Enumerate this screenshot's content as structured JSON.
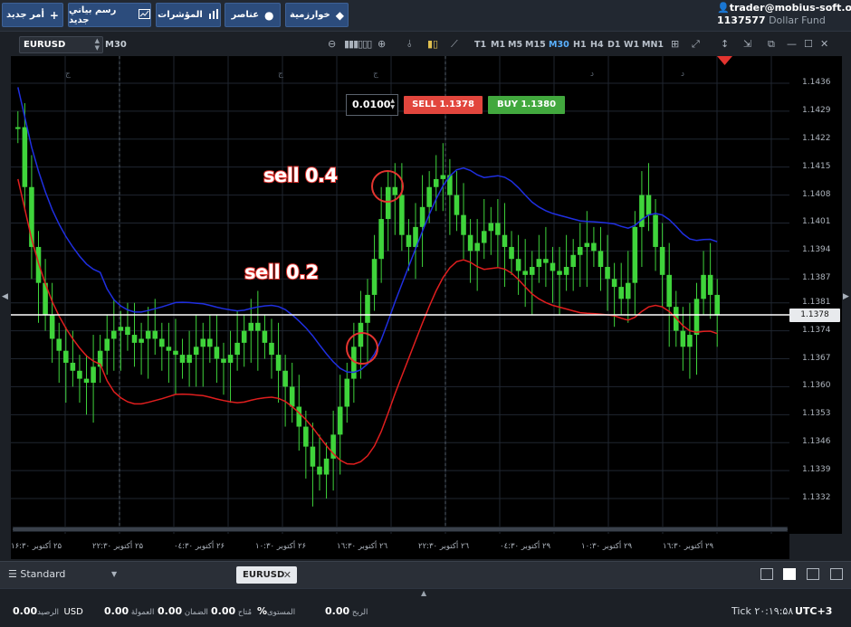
{
  "toolbar": {
    "new_order": "أمر جديد",
    "new_chart": "رسم بياني جديد",
    "indicators": "المؤشرات",
    "elements": "عناصر",
    "algorithms": "خوارزمية"
  },
  "account": {
    "user": "trader@mobius-soft.org",
    "number": "1137577",
    "fund": "Dollar Fund"
  },
  "chart": {
    "symbol": "EURUSD",
    "timeframe": "M30",
    "timeframes": [
      "T1",
      "M1",
      "M5",
      "M15",
      "M30",
      "H1",
      "H4",
      "D1",
      "W1",
      "MN1"
    ],
    "active_timeframe": "M30",
    "lot": "0.0100",
    "sell_label": "SELL 1.1378",
    "buy_label": "BUY 1.1380",
    "current_price": "1.1378",
    "price_labels": [
      "1.1436",
      "1.1429",
      "1.1422",
      "1.1415",
      "1.1408",
      "1.1401",
      "1.1394",
      "1.1387",
      "1.1381",
      "1.1374",
      "1.1367",
      "1.1360",
      "1.1353",
      "1.1346",
      "1.1339",
      "1.1332"
    ],
    "time_labels": [
      "۲۵ أكتوبر ۱۶:۳۰",
      "۲۵ أكتوبر ۲۲:۳۰",
      "۲۶ أكتوبر ۰٤:۳۰",
      "۲۶ أكتوبر ۱۰:۳۰",
      "۲٦ أكتوبر ۱٦:۳۰",
      "۲٦ أكتوبر ۲۲:۳۰",
      "۲۹ أكتوبر ۰٤:۳۰",
      "۲۹ أكتوبر ۱۰:۳۰",
      "۲۹ أكتوبر ۱٦:۳۰"
    ],
    "session_markers": [
      "ج",
      "ج",
      "ج",
      "د",
      "د"
    ],
    "annotations": [
      "sell 0.4",
      "sell 0.2"
    ],
    "colors": {
      "bull": "#3fd43b",
      "bear": "#3fd43b",
      "upper_band": "#1f2fe0",
      "lower_band": "#e01e1e",
      "price_line": "#ffffff"
    }
  },
  "tabs": {
    "layout": "Standard",
    "active_tab": "EURUSD"
  },
  "status": {
    "balance_label": "الرصيد",
    "balance": "0.00",
    "currency": "USD",
    "commission_label": "العمولة",
    "commission": "0.00",
    "margin_label": "الضمان",
    "margin": "0.00",
    "available_label": "مُتاح",
    "available": "0.00",
    "level_label": "المستوى",
    "level": "%",
    "profit_label": "الربح",
    "profit": "0.00",
    "tick_label": "Tick",
    "time": "۲۰:۱۹:۵۸",
    "utc": "UTC+3"
  }
}
